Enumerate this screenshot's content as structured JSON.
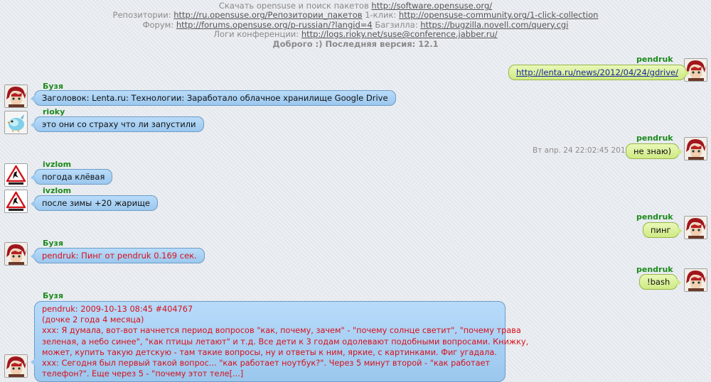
{
  "header": {
    "line1_text": "Скачать opensuse и поиск пакетов ",
    "line1_link": "http://software.opensuse.org/",
    "line2_text1": "Репозитории: ",
    "line2_link1": "http://ru.opensuse.org/Репозитории_пакетов",
    "line2_text2": " 1-клик: ",
    "line2_link2": "http://opensuse-community.org/1-click-collection",
    "line3_text1": "Форум: ",
    "line3_link1": "http://forums.opensuse.org/p-russian/?langid=4",
    "line3_text2": " Багзилла: ",
    "line3_link2": "https://bugzilla.novell.com/query.cgi",
    "line4_text": "Логи конференции: ",
    "line4_link": "http://logs.rioky.net/suse@conference.jabber.ru/",
    "line5_text": "Доброго :) Последняя версия: 12.1"
  },
  "messages": [
    {
      "nick": "pendruk",
      "text": "http://lenta.ru/news/2012/04/24/gdrive/"
    },
    {
      "nick": "Бузя",
      "text": "Заголовок: Lenta.ru: Технологии: Заработало облачное хранилище Google Drive"
    },
    {
      "nick": "rioky",
      "text": "это они со страху что ли запустили"
    },
    {
      "nick": "pendruk",
      "text": "не знаю)",
      "time": "Вт апр. 24 22:02:45 2012"
    },
    {
      "nick": "ivzlom",
      "text": "погода клёвая"
    },
    {
      "nick": "ivzlom",
      "text": "после зимы +20 жарище"
    },
    {
      "nick": "pendruk",
      "text": "пинг"
    },
    {
      "nick": "Бузя",
      "text": "pendruk: Пинг от pendruk 0.169 сек."
    },
    {
      "nick": "pendruk",
      "text": "!bash"
    },
    {
      "nick": "Бузя",
      "lines": [
        "pendruk: 2009-10-13 08:45 #404767",
        "(дочке 2 года 4 месяца)",
        "xxx: Я думала, вот-вот начнется период вопросов \"как, почему, зачем\" - \"почему солнце светит\", \"почему трава",
        "зеленая, а небо синее\", \"как птицы летают\" и т.д. Все дети к 3 годам одолевают подобными вопросами. Книжку,",
        "может, купить такую детскую - там такие вопросы, ну и ответы к ним, яркие, с картинками. Фиг угадала.",
        "xxx: Сегодня был первый такой вопрос... \"как работает ноутбук?\". Через 5 минут второй - \"как работает",
        "телефон?\". Еще через 5 - \"почему этот теле[...]"
      ]
    }
  ],
  "colors": {
    "nick": "#1d8a1d",
    "incoming": "#9cc8ee",
    "outgoing": "#cfea84",
    "highlight": "#d8101b"
  },
  "avatars": {
    "pendruk": "red-hair-avatar-icon",
    "buzya": "red-hair-avatar-icon",
    "rioky": "bird-avatar-icon",
    "ivzlom": "warning-sign-avatar-icon"
  }
}
